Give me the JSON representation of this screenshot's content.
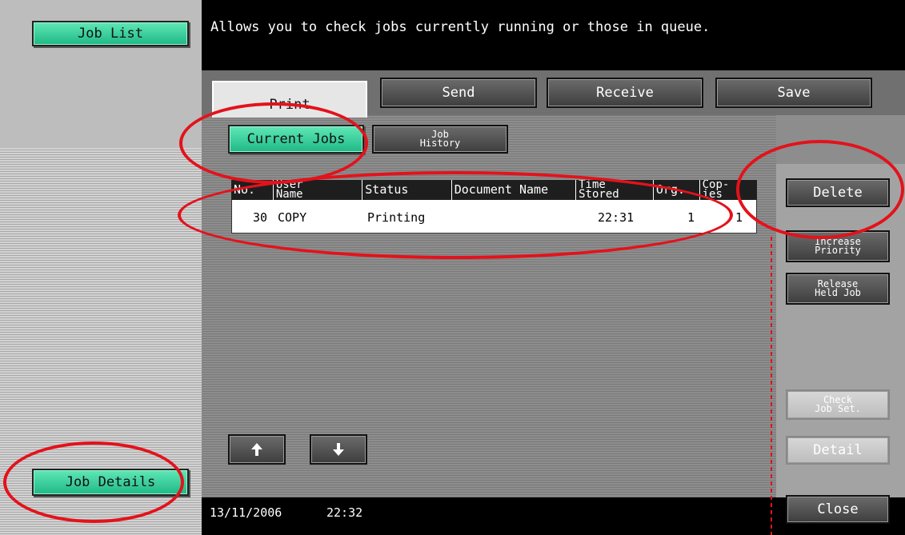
{
  "header": {
    "job_list_label": "Job List",
    "message": "Allows you to check jobs currently running or those in queue."
  },
  "tabs": [
    {
      "label": "Print",
      "active": true
    },
    {
      "label": "Send",
      "active": false
    },
    {
      "label": "Receive",
      "active": false
    },
    {
      "label": "Save",
      "active": false
    }
  ],
  "subtabs": {
    "current_jobs": "Current Jobs",
    "job_history_line1": "Job",
    "job_history_line2": "History"
  },
  "table": {
    "columns": {
      "no": "No.",
      "user_name_1": "User",
      "user_name_2": "Name",
      "status": "Status",
      "document_name": "Document Name",
      "time_stored_1": "Time",
      "time_stored_2": "Stored",
      "org": "Org.",
      "copies_1": "Cop-",
      "copies_2": "ies"
    },
    "rows": [
      {
        "no": "30",
        "user": "COPY",
        "status": "Printing",
        "document": "",
        "time": "22:31",
        "org": "1",
        "copies": "1"
      }
    ]
  },
  "right_buttons": {
    "delete": "Delete",
    "increase_1": "Increase",
    "increase_2": "Priority",
    "release_1": "Release",
    "release_2": "Held Job",
    "check_1": "Check",
    "check_2": "Job Set.",
    "detail": "Detail",
    "close": "Close"
  },
  "footer": {
    "job_details": "Job Details",
    "date": "13/11/2006",
    "time": "22:32"
  },
  "icons": {
    "scroll_up": "arrow-up-icon",
    "scroll_down": "arrow-down-icon"
  },
  "colors": {
    "accent_green": "#2cc894",
    "annotation_red": "#e3121b"
  }
}
